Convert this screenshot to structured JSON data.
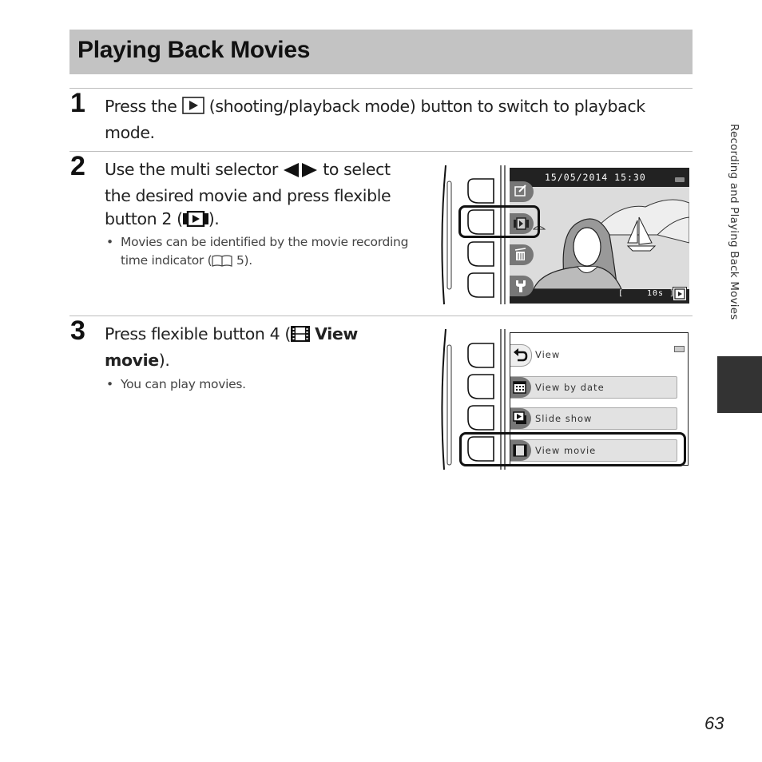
{
  "header": {
    "title": "Playing Back Movies"
  },
  "steps": [
    {
      "number": "1",
      "text_before": "Press the",
      "icon": "playback-button-icon",
      "text_after": "(shooting/playback mode) button to switch to playback",
      "text_line2": "mode."
    },
    {
      "number": "2",
      "line1_before": "Use the multi selector",
      "line1_icon": "left-right-arrows-icon",
      "line1_after": "to select",
      "line2": "the desired movie and press flexible",
      "line3_before": "button 2 (",
      "line3_icon": "movie-playback-icon",
      "line3_after": ").",
      "bullet_line1": "Movies can be identified by the movie recording",
      "bullet_line2_before": "time indicator (",
      "bullet_ref_icon": "book-reference-icon",
      "bullet_line2_after": " 5)."
    },
    {
      "number": "3",
      "line1_before": "Press flexible button 4 (",
      "line1_icon": "film-icon",
      "line1_bold": "View",
      "line2_bold": "movie",
      "line2_after": ").",
      "bullet": "You can play movies."
    }
  ],
  "screen1": {
    "datetime": "15/05/2014 15:30",
    "recording_time_open": "[",
    "recording_time": "10s ]",
    "buttons": [
      "edit-icon",
      "movie-playback-icon",
      "delete-icon",
      "wrench-icon"
    ],
    "highlighted_button": 2
  },
  "screen2": {
    "menu": [
      {
        "label": "View",
        "icon": "back-arrow-icon"
      },
      {
        "label": "View by date",
        "icon": "calendar-icon"
      },
      {
        "label": "Slide show",
        "icon": "slideshow-icon"
      },
      {
        "label": "View movie",
        "icon": "film-icon"
      }
    ],
    "highlighted_button": 4
  },
  "sidebar": {
    "section_label": "Recording and Playing Back Movies"
  },
  "footer": {
    "page_number": "63"
  }
}
